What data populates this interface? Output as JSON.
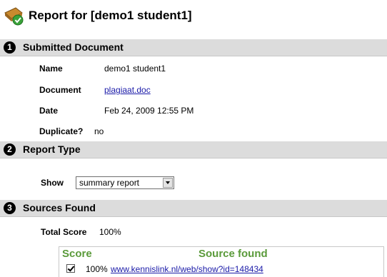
{
  "header": {
    "title": "Report for [demo1 student1]",
    "icon": "report-check-icon"
  },
  "sections": {
    "submitted": {
      "number": "1",
      "title": "Submitted Document",
      "fields": {
        "name_label": "Name",
        "name_value": "demo1 student1",
        "document_label": "Document",
        "document_value": "plagiaat.doc",
        "date_label": "Date",
        "date_value": "Feb 24, 2009 12:55 PM",
        "duplicate_label": "Duplicate?",
        "duplicate_value": "no"
      }
    },
    "report_type": {
      "number": "2",
      "title": "Report Type",
      "show_label": "Show",
      "show_selected": "summary report"
    },
    "sources": {
      "number": "3",
      "title": "Sources Found",
      "total_score_label": "Total Score",
      "total_score_value": "100%",
      "columns": {
        "score": "Score",
        "source": "Source found"
      },
      "rows": [
        {
          "checked": true,
          "score": "100%",
          "source": "www.kennislink.nl/web/show?id=148434"
        }
      ]
    }
  },
  "colors": {
    "section_header_bg": "#dcdcdc",
    "link": "#1a1aa8",
    "column_header": "#5a9a3a"
  }
}
